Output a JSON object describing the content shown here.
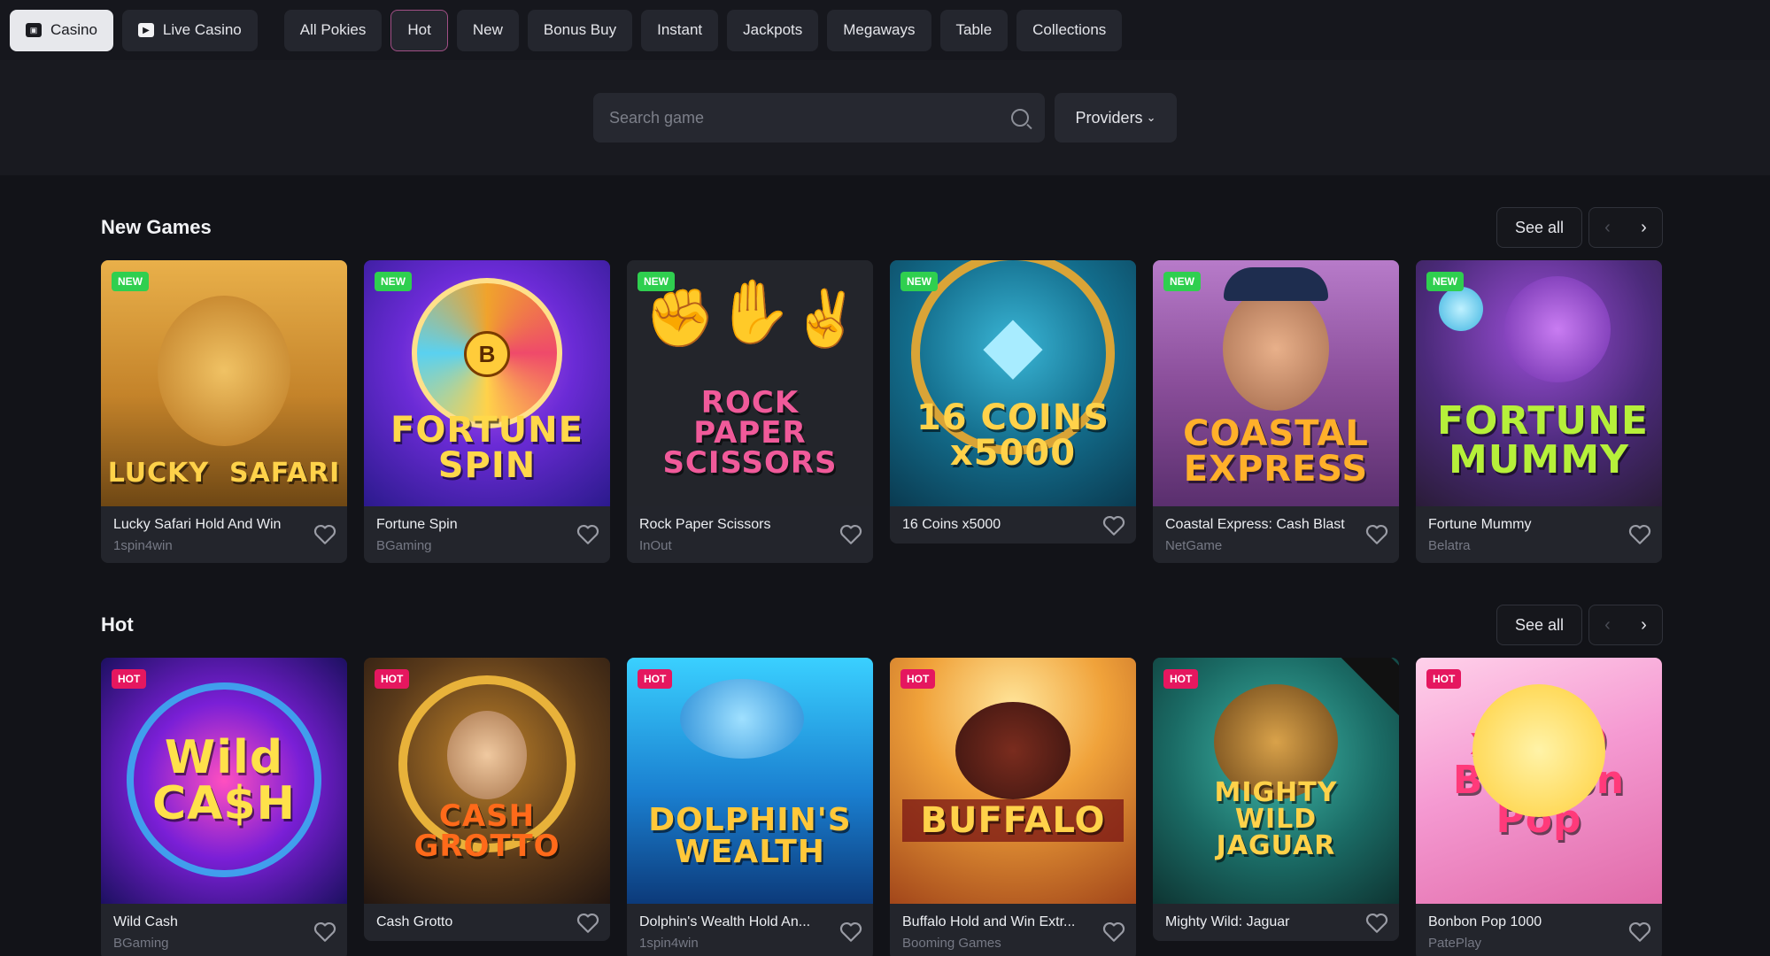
{
  "nav": {
    "casino": "Casino",
    "live_casino": "Live Casino",
    "tabs": [
      "All Pokies",
      "Hot",
      "New",
      "Bonus Buy",
      "Instant",
      "Jackpots",
      "Megaways",
      "Table",
      "Collections"
    ],
    "selected_tab": "Hot"
  },
  "search": {
    "placeholder": "Search game"
  },
  "providers_label": "Providers",
  "sections": {
    "new_games": {
      "title": "New Games",
      "see_all": "See all",
      "badge": "NEW",
      "games": [
        {
          "name": "Lucky Safari Hold And Win",
          "provider": "1spin4win",
          "logo": "LUCKY  SAFARI"
        },
        {
          "name": "Fortune Spin",
          "provider": "BGaming",
          "logo": "FORTUNE SPIN"
        },
        {
          "name": "Rock Paper Scissors",
          "provider": "InOut",
          "logo": "ROCK PAPER SCISSORS"
        },
        {
          "name": "16 Coins x5000",
          "provider": "",
          "logo": "16 COINS x5000"
        },
        {
          "name": "Coastal Express: Cash Blast",
          "provider": "NetGame",
          "logo": "COASTAL EXPRESS"
        },
        {
          "name": "Fortune Mummy",
          "provider": "Belatra",
          "logo": "FORTUNE MUMMY"
        }
      ]
    },
    "hot": {
      "title": "Hot",
      "see_all": "See all",
      "badge": "HOT",
      "games": [
        {
          "name": "Wild Cash",
          "provider": "BGaming",
          "logo": "Wild CA$H"
        },
        {
          "name": "Cash Grotto",
          "provider": "",
          "logo": "CASH GROTTO"
        },
        {
          "name": "Dolphin's Wealth Hold An...",
          "provider": "1spin4win",
          "logo": "DOLPHIN'S WEALTH"
        },
        {
          "name": "Buffalo Hold and Win Extr...",
          "provider": "Booming Games",
          "logo": "BUFFALO"
        },
        {
          "name": "Mighty Wild: Jaguar",
          "provider": "",
          "logo": "MIGHTY WILD JAGUAR"
        },
        {
          "name": "Bonbon Pop 1000",
          "provider": "PatePlay",
          "logo": "x1000 Bonbon Pop"
        }
      ]
    }
  },
  "colors": {
    "accent_selected": "#a14f85",
    "badge_new": "#2fcf4f",
    "badge_hot": "#e5175f"
  }
}
